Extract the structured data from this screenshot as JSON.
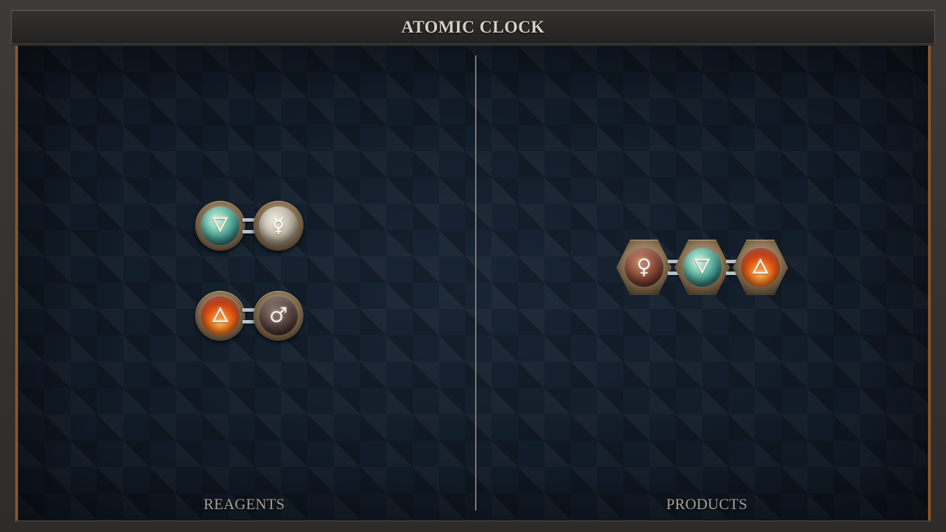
{
  "title": "ATOMIC CLOCK",
  "panels": {
    "reagents_label": "REAGENTS",
    "products_label": "PRODUCTS"
  },
  "reagents": [
    {
      "atoms": [
        {
          "element": "water",
          "glyph": "🜄",
          "color": "#4fa99a"
        },
        {
          "element": "quicksilver",
          "glyph": "☿",
          "color": "#c7c0ae"
        }
      ],
      "bonds": 1
    },
    {
      "atoms": [
        {
          "element": "fire",
          "glyph": "🜂",
          "color": "#f06a18"
        },
        {
          "element": "iron",
          "glyph": "♂",
          "color": "#5a4642"
        }
      ],
      "bonds": 1
    }
  ],
  "products": [
    {
      "atoms": [
        {
          "element": "copper",
          "glyph": "♀",
          "color": "#92503d"
        },
        {
          "element": "water",
          "glyph": "🜄",
          "color": "#4fa99a"
        },
        {
          "element": "fire",
          "glyph": "🜂",
          "color": "#f06a18"
        }
      ],
      "bonds": 2
    }
  ],
  "colors": {
    "frame": "#2e2c2a",
    "board": "#152130",
    "accent_border": "#8a5428",
    "title_text": "#d6cfc2",
    "label_text": "#a9a296"
  }
}
